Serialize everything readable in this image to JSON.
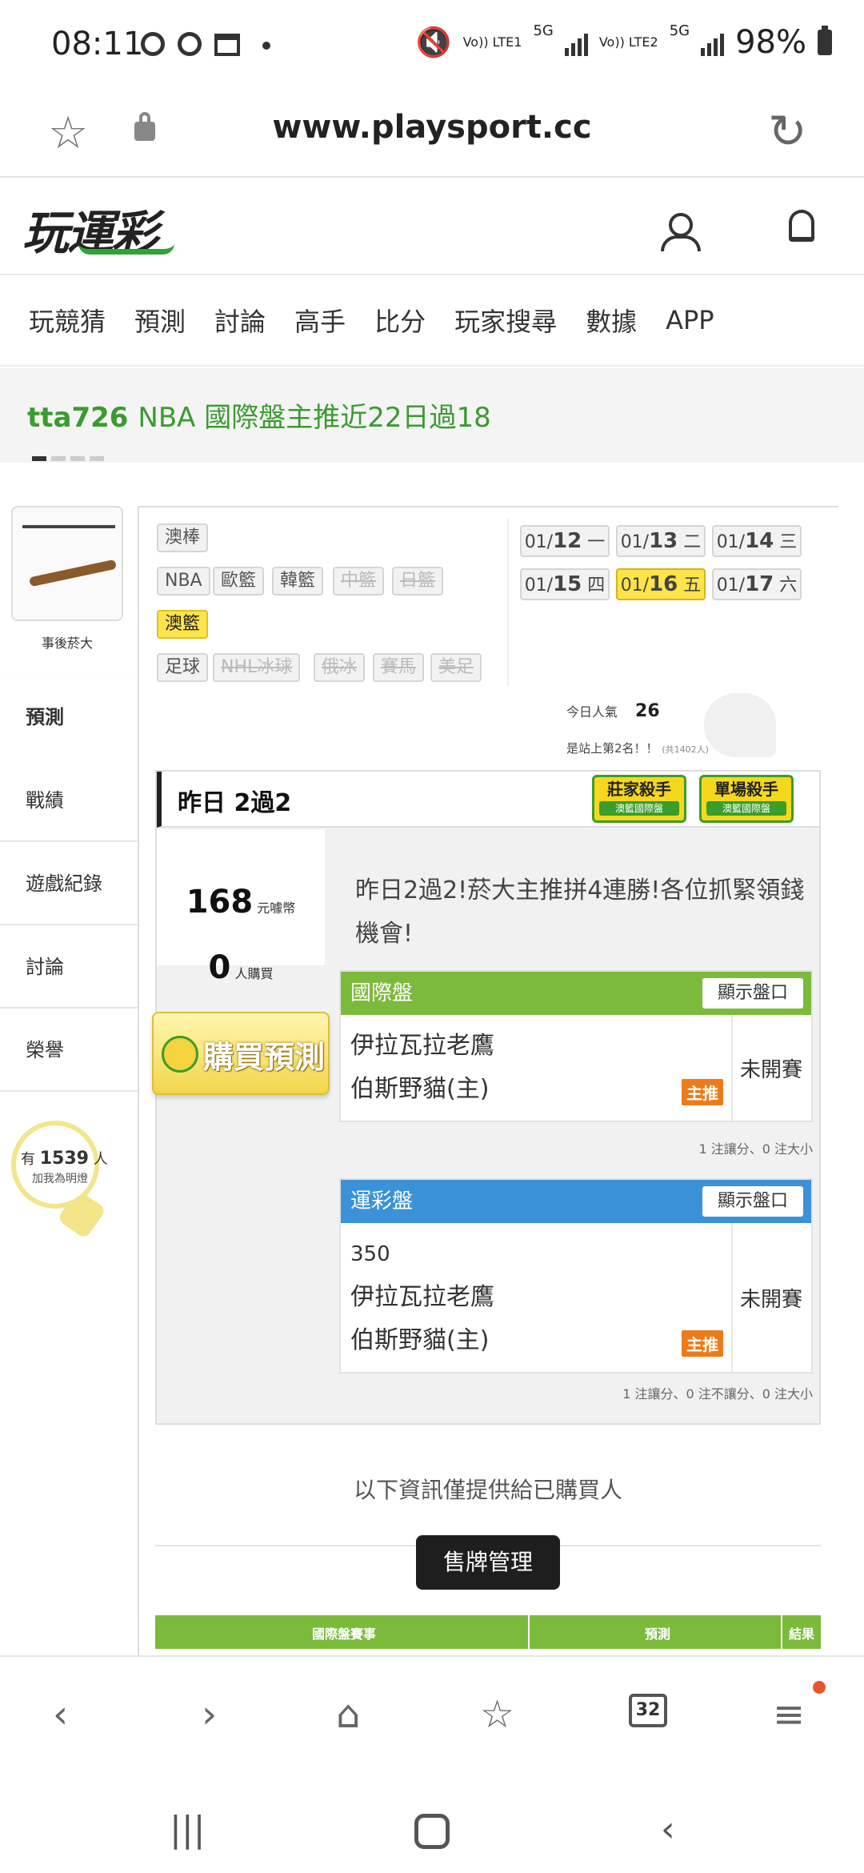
{
  "status_bar": {
    "time": "08:11",
    "network1": "Vo)) LTE1",
    "net_5g_1": "5G",
    "network2": "Vo)) LTE2",
    "net_5g_2": "5G",
    "battery": "98%"
  },
  "browser": {
    "url": "www.playsport.cc",
    "tab_count": "32"
  },
  "site": {
    "logo": "玩運彩",
    "nav": [
      "玩競猜",
      "預測",
      "討論",
      "高手",
      "比分",
      "玩家搜尋",
      "數據",
      "APP"
    ]
  },
  "banner": {
    "user": "tta726",
    "text": "NBA 國際盤主推近22日過18"
  },
  "profile": {
    "name": "事後菸大",
    "menu": [
      "預測",
      "戰績",
      "遊戲紀錄",
      "討論",
      "榮譽"
    ],
    "supporters_prefix": "有",
    "supporters_count": "1539",
    "supporters_suffix": "人",
    "supporters_caption": "加我為明燈"
  },
  "categories": {
    "row1": [
      "澳棒"
    ],
    "row2": [
      "NBA",
      "歐籃",
      "韓籃",
      "中籃",
      "日籃"
    ],
    "row3": [
      "澳籃"
    ],
    "row4": [
      "足球",
      "NHL冰球",
      "俄冰",
      "賽馬",
      "美足"
    ]
  },
  "dates": [
    {
      "m": "01/",
      "d": "12",
      "w": "一"
    },
    {
      "m": "01/",
      "d": "13",
      "w": "二"
    },
    {
      "m": "01/",
      "d": "14",
      "w": "三"
    },
    {
      "m": "01/",
      "d": "15",
      "w": "四"
    },
    {
      "m": "01/",
      "d": "16",
      "w": "五"
    },
    {
      "m": "01/",
      "d": "17",
      "w": "六"
    }
  ],
  "popularity": {
    "label": "今日人氣",
    "value": "26",
    "rank_text": "是站上第2名！！",
    "rank_total": "(共1402人)"
  },
  "panel": {
    "title": "昨日 2過2",
    "badge1": {
      "title": "莊家殺手",
      "sub": "澳籃國際盤"
    },
    "badge2": {
      "title": "單場殺手",
      "sub": "澳籃國際盤"
    },
    "price": "168",
    "price_unit": "元噱幣",
    "buyers": "0",
    "buyers_unit": "人購買",
    "buy_button": "購買預測",
    "message": "昨日2過2!菸大主推拼4連勝!各位抓緊領錢機會!"
  },
  "intl_game": {
    "header": "國際盤",
    "show_label": "顯示盤口",
    "away": "伊拉瓦拉老鷹",
    "home": "伯斯野貓(主)",
    "pick_tag": "主推",
    "state": "未開賽",
    "note": "1 注讓分、0 注大小"
  },
  "local_game": {
    "header": "運彩盤",
    "show_label": "顯示盤口",
    "code": "350",
    "away": "伊拉瓦拉老鷹",
    "home": "伯斯野貓(主)",
    "pick_tag": "主推",
    "state": "未開賽",
    "note": "1 注讓分、0 注不讓分、0 注大小"
  },
  "buyer_only_text": "以下資訊僅提供給已購買人",
  "sell_button": "售牌管理",
  "table_headers": [
    "國際盤賽事",
    "預測",
    "結果"
  ]
}
